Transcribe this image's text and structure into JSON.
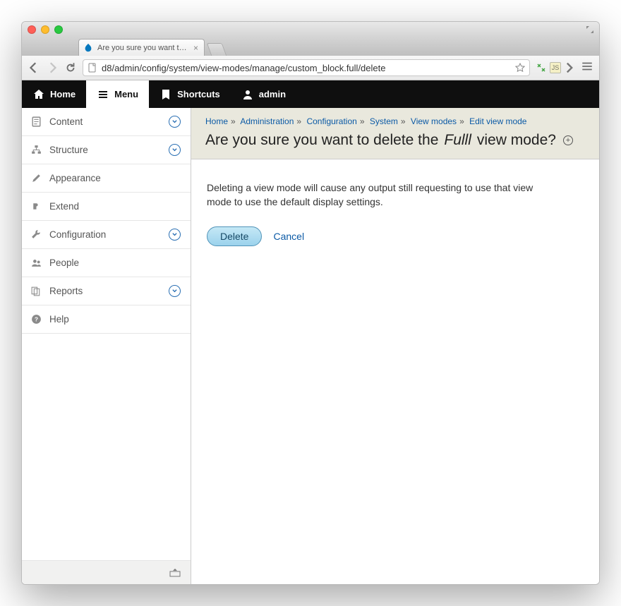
{
  "browser": {
    "tab_title": "Are you sure you want to d",
    "url": "d8/admin/config/system/view-modes/manage/custom_block.full/delete"
  },
  "toolbar": {
    "home": "Home",
    "menu": "Menu",
    "shortcuts": "Shortcuts",
    "user": "admin"
  },
  "sidebar": {
    "items": [
      {
        "label": "Content",
        "expandable": true
      },
      {
        "label": "Structure",
        "expandable": true
      },
      {
        "label": "Appearance",
        "expandable": false
      },
      {
        "label": "Extend",
        "expandable": false
      },
      {
        "label": "Configuration",
        "expandable": true
      },
      {
        "label": "People",
        "expandable": false
      },
      {
        "label": "Reports",
        "expandable": true
      },
      {
        "label": "Help",
        "expandable": false
      }
    ]
  },
  "breadcrumb": [
    "Home",
    "Administration",
    "Configuration",
    "System",
    "View modes",
    "Edit view mode"
  ],
  "page": {
    "title_pre": "Are you sure you want to delete the ",
    "title_em": "Fulll",
    "title_post": " view mode?",
    "description": "Deleting a view mode will cause any output still requesting to use that view mode to use the default display settings.",
    "delete_label": "Delete",
    "cancel_label": "Cancel"
  }
}
